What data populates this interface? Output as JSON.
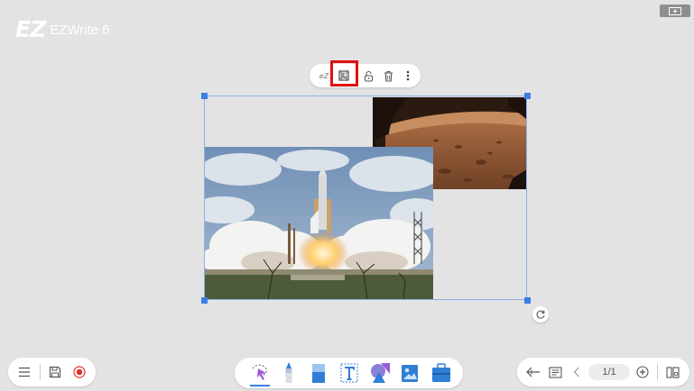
{
  "app": {
    "title": "EZWrite 6",
    "logo_mark": "EZ"
  },
  "selection_toolbar": {
    "ez_label": "eZ",
    "items": [
      {
        "name": "crop-icon",
        "highlighted": true
      },
      {
        "name": "lock-icon"
      },
      {
        "name": "trash-icon"
      },
      {
        "name": "more-icon"
      }
    ],
    "highlight_color": "#e01010"
  },
  "canvas": {
    "selection_color": "#3d7ee6",
    "images": [
      {
        "subject": "mars-surface-photo"
      },
      {
        "subject": "space-shuttle-launch-photo"
      }
    ]
  },
  "bottom_left": {
    "items": [
      "menu-icon",
      "save-icon",
      "record-icon"
    ]
  },
  "bottom_center": {
    "tools": [
      "lasso-select-tool",
      "pen-tool",
      "eraser-tool",
      "text-tool",
      "shape-tool",
      "image-tool",
      "toolbox-tool"
    ],
    "active_tool": "lasso-select-tool"
  },
  "bottom_right": {
    "page_indicator": "1/1",
    "items": [
      "back-icon",
      "notes-icon",
      "prev-page-icon",
      "add-page-icon",
      "page-overview-icon"
    ]
  },
  "colors": {
    "background": "#e3e3e3",
    "accent": "#3d7ee6",
    "tool_blue": "#2f7fd6"
  }
}
